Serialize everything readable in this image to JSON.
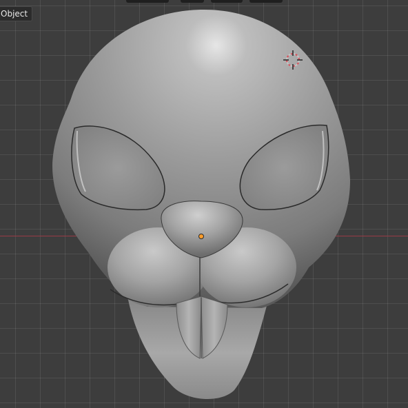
{
  "viewport": {
    "mode_label": "Object"
  },
  "colors": {
    "background": "#3d3d3d",
    "grid": "#4f4f4f",
    "x_axis": "#9a3b46",
    "mesh": "#9a9a9a"
  },
  "icons": [
    "3d-cursor-icon",
    "origin-point-icon"
  ]
}
